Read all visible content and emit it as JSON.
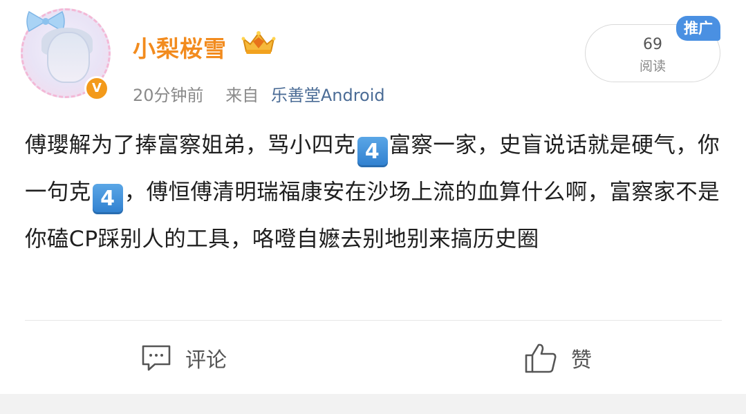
{
  "author": {
    "name": "小梨桜雪",
    "verified_badge": "V",
    "avatar_icon": "anime-girl-avatar",
    "badge_icon": "crown-badge-icon"
  },
  "meta": {
    "time": "20分钟前",
    "source_prefix": "来自",
    "source": "乐善堂Android"
  },
  "stats": {
    "read_count": "69",
    "read_label": "阅读"
  },
  "promo_tag": "推广",
  "post": {
    "segments": [
      "傅瓔解为了捧富察姐弟，骂小四克",
      "4",
      "富察一家，史盲说话就是硬气，你一句克",
      "4",
      "，傅恒傅清明瑞福康安在沙场上流的血算什么啊，富察家不是你磕CP踩别人的工具，咯噔自嬷去别地别来搞历史圈"
    ]
  },
  "actions": {
    "comment_label": "评论",
    "like_label": "赞"
  },
  "colors": {
    "username": "#f28b1e",
    "source_link": "#4b6c96",
    "promo_tag_bg": "#4a90e2",
    "keycap_bg": "#3a8ad9"
  }
}
